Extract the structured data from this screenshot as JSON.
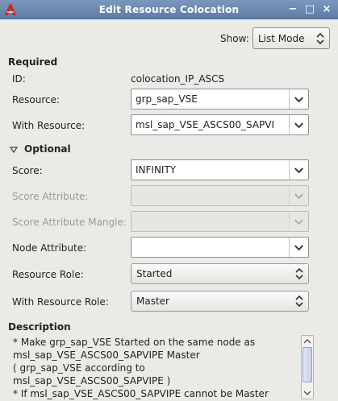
{
  "window": {
    "title": "Edit Resource Colocation",
    "controls": [
      "−",
      "□",
      "×"
    ]
  },
  "show": {
    "label": "Show:",
    "value": "List Mode"
  },
  "required": {
    "heading": "Required",
    "id_label": "ID:",
    "id_value": "colocation_IP_ASCS",
    "resource_label": "Resource:",
    "resource_value": "grp_sap_VSE",
    "with_resource_label": "With Resource:",
    "with_resource_value": "msl_sap_VSE_ASCS00_SAPVI"
  },
  "optional": {
    "heading": "Optional",
    "score_label": "Score:",
    "score_value": "INFINITY",
    "score_attribute_label": "Score Attribute:",
    "score_attribute_value": "",
    "score_attribute_mangle_label": "Score Attribute Mangle:",
    "score_attribute_mangle_value": "",
    "node_attribute_label": "Node Attribute:",
    "node_attribute_value": "",
    "resource_role_label": "Resource Role:",
    "resource_role_value": "Started",
    "with_resource_role_label": "With Resource Role:",
    "with_resource_role_value": "Master"
  },
  "description": {
    "heading": "Description",
    "lines": [
      "* Make grp_sap_VSE Started on the same node as",
      "msl_sap_VSE_ASCS00_SAPVIPE Master",
      "( grp_sap_VSE according to",
      "msl_sap_VSE_ASCS00_SAPVIPE )",
      "* If msl_sap_VSE_ASCS00_SAPVIPE cannot be Master"
    ]
  }
}
